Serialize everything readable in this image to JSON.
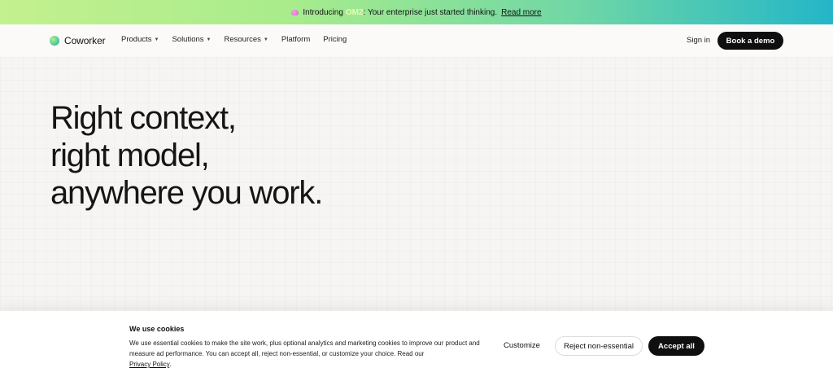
{
  "banner": {
    "prefix": "Introducing",
    "highlight": "OM2",
    "message": ": Your enterprise just started thinking.",
    "link": "Read more"
  },
  "nav": {
    "brand": "Coworker",
    "items": [
      {
        "label": "Products",
        "has_dropdown": true
      },
      {
        "label": "Solutions",
        "has_dropdown": true
      },
      {
        "label": "Resources",
        "has_dropdown": true
      },
      {
        "label": "Platform",
        "has_dropdown": false
      },
      {
        "label": "Pricing",
        "has_dropdown": false
      }
    ],
    "signin": "Sign in",
    "cta": "Book a demo"
  },
  "hero": {
    "lines": [
      "Right context,",
      "right model,",
      "anywhere you work."
    ]
  },
  "cookie": {
    "title": "We use cookies",
    "body": "We use essential cookies to make the site work, plus optional analytics and marketing cookies to improve our product and measure ad performance. You can accept all, reject non-essential, or customize your choice. Read our",
    "policy_link": "Privacy Policy",
    "policy_suffix": ".",
    "customize": "Customize",
    "reject": "Reject non-essential",
    "accept": "Accept all"
  },
  "colors": {
    "banner_start": "#c4f08e",
    "banner_end": "#23b6c8",
    "cta_bg": "#0f0f10",
    "page_bg": "#f7f5f3"
  }
}
